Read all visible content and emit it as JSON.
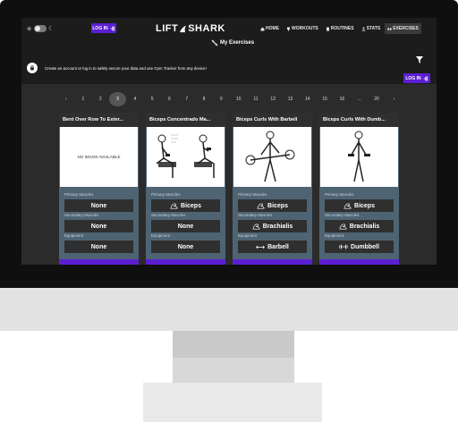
{
  "header": {
    "login_label": "LOG IN",
    "logo_left": "LIFT",
    "logo_right": "SHARK",
    "nav": [
      {
        "label": "HOME",
        "icon": "home-icon"
      },
      {
        "label": "WORKOUTS",
        "icon": "trophy-icon"
      },
      {
        "label": "ROUTINES",
        "icon": "book-icon"
      },
      {
        "label": "STATS",
        "icon": "person-icon"
      },
      {
        "label": "EXERCISES",
        "icon": "dumbbell-icon",
        "active": true
      }
    ]
  },
  "page": {
    "title": "My Exercises",
    "notice": "Create an account or log in to safely secure your data and use Gym Tracker from any device!",
    "login_label": "LOG IN"
  },
  "pagination": {
    "prev": "‹",
    "next": "›",
    "pages": [
      "1",
      "2",
      "3",
      "4",
      "5",
      "6",
      "7",
      "8",
      "9",
      "10",
      "11",
      "12",
      "13",
      "14",
      "15",
      "16",
      "…",
      "20"
    ],
    "current": "3"
  },
  "field_labels": {
    "primary": "Primary Muscles",
    "secondary": "Secondary Muscles",
    "equipment": "Equipment"
  },
  "cards": [
    {
      "title": "Bent Over Row To Exter...",
      "image_text": "NO IMAGE AVAILABLE",
      "primary": "None",
      "secondary": "None",
      "equipment": "None"
    },
    {
      "title": "Biceps Concentrado Ma...",
      "primary": "Biceps",
      "secondary": "None",
      "equipment": "None"
    },
    {
      "title": "Biceps Curls With Barbell",
      "primary": "Biceps",
      "secondary": "Brachialis",
      "equipment": "Barbell"
    },
    {
      "title": "Biceps Curls With Dumb...",
      "primary": "Biceps",
      "secondary": "Brachialis",
      "equipment": "Dumbbell"
    }
  ],
  "colors": {
    "accent": "#5b1fd1",
    "card_bg": "#4e6473",
    "screen_bg": "#2b2b2b"
  }
}
